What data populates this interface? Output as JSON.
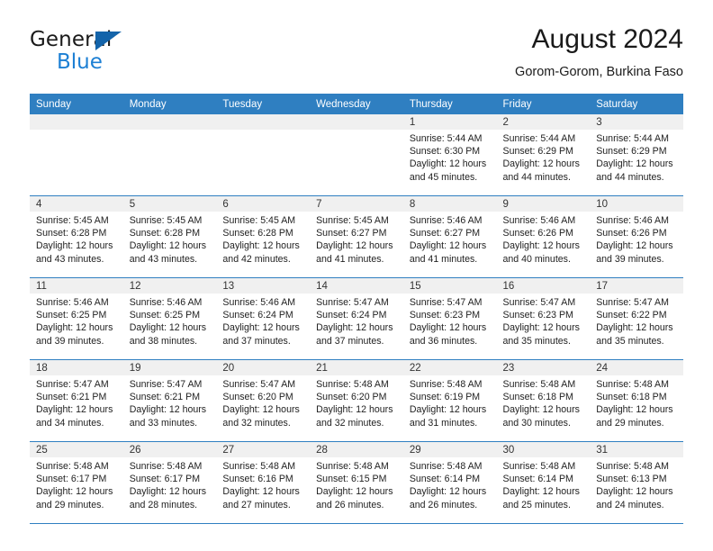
{
  "brand": {
    "line1": "General",
    "line2": "Blue",
    "triangle_color": "#1464aa",
    "blue_text_color": "#1c7fd4"
  },
  "header": {
    "month_title": "August 2024",
    "location": "Gorom-Gorom, Burkina Faso"
  },
  "theme": {
    "header_blue": "#2f7fc1",
    "date_band_gray": "#f0f0f0",
    "text": "#222222"
  },
  "calendar": {
    "day_headers": [
      "Sunday",
      "Monday",
      "Tuesday",
      "Wednesday",
      "Thursday",
      "Friday",
      "Saturday"
    ],
    "weeks": [
      [
        {
          "date": "",
          "empty": true
        },
        {
          "date": "",
          "empty": true
        },
        {
          "date": "",
          "empty": true
        },
        {
          "date": "",
          "empty": true
        },
        {
          "date": "1",
          "sunrise": "Sunrise: 5:44 AM",
          "sunset": "Sunset: 6:30 PM",
          "daylight": "Daylight: 12 hours and 45 minutes."
        },
        {
          "date": "2",
          "sunrise": "Sunrise: 5:44 AM",
          "sunset": "Sunset: 6:29 PM",
          "daylight": "Daylight: 12 hours and 44 minutes."
        },
        {
          "date": "3",
          "sunrise": "Sunrise: 5:44 AM",
          "sunset": "Sunset: 6:29 PM",
          "daylight": "Daylight: 12 hours and 44 minutes."
        }
      ],
      [
        {
          "date": "4",
          "sunrise": "Sunrise: 5:45 AM",
          "sunset": "Sunset: 6:28 PM",
          "daylight": "Daylight: 12 hours and 43 minutes."
        },
        {
          "date": "5",
          "sunrise": "Sunrise: 5:45 AM",
          "sunset": "Sunset: 6:28 PM",
          "daylight": "Daylight: 12 hours and 43 minutes."
        },
        {
          "date": "6",
          "sunrise": "Sunrise: 5:45 AM",
          "sunset": "Sunset: 6:28 PM",
          "daylight": "Daylight: 12 hours and 42 minutes."
        },
        {
          "date": "7",
          "sunrise": "Sunrise: 5:45 AM",
          "sunset": "Sunset: 6:27 PM",
          "daylight": "Daylight: 12 hours and 41 minutes."
        },
        {
          "date": "8",
          "sunrise": "Sunrise: 5:46 AM",
          "sunset": "Sunset: 6:27 PM",
          "daylight": "Daylight: 12 hours and 41 minutes."
        },
        {
          "date": "9",
          "sunrise": "Sunrise: 5:46 AM",
          "sunset": "Sunset: 6:26 PM",
          "daylight": "Daylight: 12 hours and 40 minutes."
        },
        {
          "date": "10",
          "sunrise": "Sunrise: 5:46 AM",
          "sunset": "Sunset: 6:26 PM",
          "daylight": "Daylight: 12 hours and 39 minutes."
        }
      ],
      [
        {
          "date": "11",
          "sunrise": "Sunrise: 5:46 AM",
          "sunset": "Sunset: 6:25 PM",
          "daylight": "Daylight: 12 hours and 39 minutes."
        },
        {
          "date": "12",
          "sunrise": "Sunrise: 5:46 AM",
          "sunset": "Sunset: 6:25 PM",
          "daylight": "Daylight: 12 hours and 38 minutes."
        },
        {
          "date": "13",
          "sunrise": "Sunrise: 5:46 AM",
          "sunset": "Sunset: 6:24 PM",
          "daylight": "Daylight: 12 hours and 37 minutes."
        },
        {
          "date": "14",
          "sunrise": "Sunrise: 5:47 AM",
          "sunset": "Sunset: 6:24 PM",
          "daylight": "Daylight: 12 hours and 37 minutes."
        },
        {
          "date": "15",
          "sunrise": "Sunrise: 5:47 AM",
          "sunset": "Sunset: 6:23 PM",
          "daylight": "Daylight: 12 hours and 36 minutes."
        },
        {
          "date": "16",
          "sunrise": "Sunrise: 5:47 AM",
          "sunset": "Sunset: 6:23 PM",
          "daylight": "Daylight: 12 hours and 35 minutes."
        },
        {
          "date": "17",
          "sunrise": "Sunrise: 5:47 AM",
          "sunset": "Sunset: 6:22 PM",
          "daylight": "Daylight: 12 hours and 35 minutes."
        }
      ],
      [
        {
          "date": "18",
          "sunrise": "Sunrise: 5:47 AM",
          "sunset": "Sunset: 6:21 PM",
          "daylight": "Daylight: 12 hours and 34 minutes."
        },
        {
          "date": "19",
          "sunrise": "Sunrise: 5:47 AM",
          "sunset": "Sunset: 6:21 PM",
          "daylight": "Daylight: 12 hours and 33 minutes."
        },
        {
          "date": "20",
          "sunrise": "Sunrise: 5:47 AM",
          "sunset": "Sunset: 6:20 PM",
          "daylight": "Daylight: 12 hours and 32 minutes."
        },
        {
          "date": "21",
          "sunrise": "Sunrise: 5:48 AM",
          "sunset": "Sunset: 6:20 PM",
          "daylight": "Daylight: 12 hours and 32 minutes."
        },
        {
          "date": "22",
          "sunrise": "Sunrise: 5:48 AM",
          "sunset": "Sunset: 6:19 PM",
          "daylight": "Daylight: 12 hours and 31 minutes."
        },
        {
          "date": "23",
          "sunrise": "Sunrise: 5:48 AM",
          "sunset": "Sunset: 6:18 PM",
          "daylight": "Daylight: 12 hours and 30 minutes."
        },
        {
          "date": "24",
          "sunrise": "Sunrise: 5:48 AM",
          "sunset": "Sunset: 6:18 PM",
          "daylight": "Daylight: 12 hours and 29 minutes."
        }
      ],
      [
        {
          "date": "25",
          "sunrise": "Sunrise: 5:48 AM",
          "sunset": "Sunset: 6:17 PM",
          "daylight": "Daylight: 12 hours and 29 minutes."
        },
        {
          "date": "26",
          "sunrise": "Sunrise: 5:48 AM",
          "sunset": "Sunset: 6:17 PM",
          "daylight": "Daylight: 12 hours and 28 minutes."
        },
        {
          "date": "27",
          "sunrise": "Sunrise: 5:48 AM",
          "sunset": "Sunset: 6:16 PM",
          "daylight": "Daylight: 12 hours and 27 minutes."
        },
        {
          "date": "28",
          "sunrise": "Sunrise: 5:48 AM",
          "sunset": "Sunset: 6:15 PM",
          "daylight": "Daylight: 12 hours and 26 minutes."
        },
        {
          "date": "29",
          "sunrise": "Sunrise: 5:48 AM",
          "sunset": "Sunset: 6:14 PM",
          "daylight": "Daylight: 12 hours and 26 minutes."
        },
        {
          "date": "30",
          "sunrise": "Sunrise: 5:48 AM",
          "sunset": "Sunset: 6:14 PM",
          "daylight": "Daylight: 12 hours and 25 minutes."
        },
        {
          "date": "31",
          "sunrise": "Sunrise: 5:48 AM",
          "sunset": "Sunset: 6:13 PM",
          "daylight": "Daylight: 12 hours and 24 minutes."
        }
      ]
    ]
  }
}
